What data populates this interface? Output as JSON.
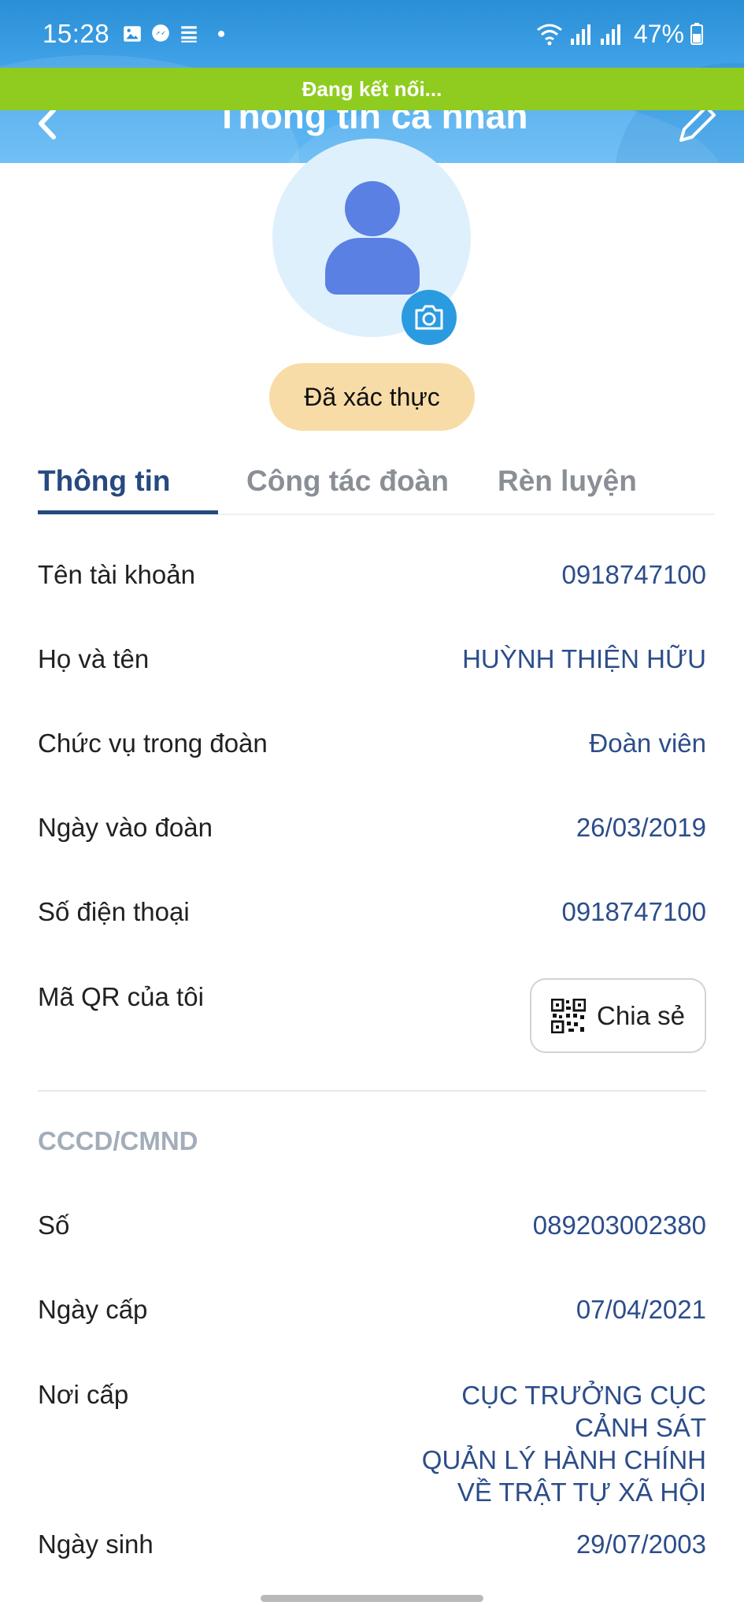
{
  "status_bar": {
    "time": "15:28",
    "battery": "47%"
  },
  "banner": {
    "text": "Đang kết nối..."
  },
  "nav": {
    "title": "Thông tin cá nhân"
  },
  "profile": {
    "verified_label": "Đã xác thực"
  },
  "tabs": [
    {
      "label": "Thông tin",
      "active": true
    },
    {
      "label": "Công tác đoàn",
      "active": false
    },
    {
      "label": "Rèn luyện",
      "active": false
    }
  ],
  "info": {
    "username": {
      "label": "Tên tài khoản",
      "value": "0918747100"
    },
    "fullname": {
      "label": "Họ và tên",
      "value": "HUỲNH THIỆN HỮU"
    },
    "position": {
      "label": "Chức vụ trong đoàn",
      "value": "Đoàn viên"
    },
    "join_date": {
      "label": "Ngày vào đoàn",
      "value": "26/03/2019"
    },
    "phone": {
      "label": "Số điện thoại",
      "value": "0918747100"
    },
    "qr": {
      "label": "Mã QR của tôi",
      "share_label": "Chia sẻ"
    }
  },
  "id_card": {
    "section_title": "CCCD/CMND",
    "number": {
      "label": "Số",
      "value": "089203002380"
    },
    "issue_date": {
      "label": "Ngày cấp",
      "value": "07/04/2021"
    },
    "issue_place": {
      "label": "Nơi cấp",
      "lines": [
        "CỤC TRƯỞNG CỤC",
        "CẢNH SÁT",
        "QUẢN LÝ HÀNH CHÍNH",
        "VỀ TRẬT TỰ XÃ HỘI"
      ]
    },
    "birth_date": {
      "label": "Ngày sinh",
      "value": "29/07/2003"
    }
  },
  "colors": {
    "header_blue": "#49a9ee",
    "banner_green": "#8fcc1f",
    "accent_navy": "#26497f",
    "value_blue": "#2c4d8a",
    "badge_bg": "#f8dca7"
  }
}
